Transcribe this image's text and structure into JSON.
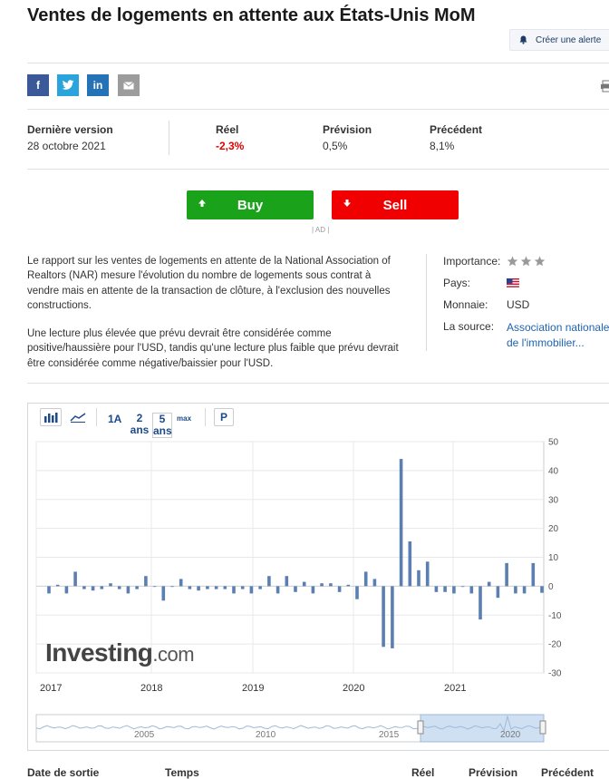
{
  "header": {
    "title": "Ventes de logements en attente aux États-Unis MoM",
    "alert_button": "Créer une alerte"
  },
  "share": [
    {
      "name": "facebook-share-button",
      "glyph": "f",
      "color": "#3b5998"
    },
    {
      "name": "twitter-share-button",
      "glyph": "t",
      "color": "#2ba4db"
    },
    {
      "name": "linkedin-share-button",
      "glyph": "in",
      "color": "#2572b6"
    },
    {
      "name": "email-share-button",
      "glyph": "✉",
      "color": "#9c9c9c"
    }
  ],
  "stats": {
    "version_label": "Dernière version",
    "version_date": "28 octobre 2021",
    "actual_label": "Réel",
    "actual_value": "-2,3%",
    "forecast_label": "Prévision",
    "forecast_value": "0,5%",
    "previous_label": "Précédent",
    "previous_value": "8,1%",
    "actual_color": "#e00000"
  },
  "trade": {
    "buy_label": "Buy",
    "sell_label": "Sell",
    "ad_label": "| AD |",
    "buy_color": "#1aa31a",
    "sell_color": "#f00000"
  },
  "description": {
    "paragraph1": "Le rapport sur les ventes de logements en attente de la National Association of Realtors (NAR) mesure l'évolution du nombre de logements sous contrat à vendre mais en attente de la transaction de clôture, à l'exclusion des nouvelles constructions.",
    "paragraph2": "Une lecture plus élevée que prévu devrait être considérée comme positive/haussière pour l'USD, tandis qu'une lecture plus faible que prévu devrait être considérée comme négative/baissier pour l'USD."
  },
  "info": {
    "importance_label": "Importance:",
    "importance_stars": 3,
    "country_label": "Pays:",
    "currency_label": "Monnaie:",
    "currency_value": "USD",
    "source_label": "La source:",
    "source_value": "Association nationale de l'immobilier..."
  },
  "toolbar": {
    "range_1y": "1A",
    "range_2y": "2 ans",
    "range_5y": "5 ans",
    "range_max": "max",
    "p_button": "P"
  },
  "chart_data": {
    "type": "bar",
    "ylim": [
      -30,
      50
    ],
    "y_ticks": [
      "50",
      "40",
      "30",
      "20",
      "10",
      "0",
      "-10",
      "-20",
      "-30"
    ],
    "x_tick_labels": [
      "2017",
      "2018",
      "2019",
      "2020",
      "2021"
    ],
    "color": "#5b7fb0",
    "grid": true,
    "values": [
      -2.5,
      0.5,
      -2.5,
      5.0,
      -1.0,
      -1.5,
      -1.0,
      1.0,
      -1.0,
      -2.5,
      -1.0,
      3.5,
      0.0,
      -5.0,
      0.0,
      2.5,
      -1.0,
      -1.5,
      -1.0,
      -1.0,
      -1.0,
      -2.5,
      -1.0,
      -2.5,
      -1.0,
      3.5,
      -2.5,
      3.5,
      -2.0,
      1.5,
      -2.5,
      1.0,
      1.0,
      -2.0,
      0.5,
      -4.5,
      5.0,
      2.5,
      -21.0,
      -21.5,
      44.0,
      15.5,
      5.5,
      8.5,
      -2.0,
      -2.0,
      -2.5,
      0.0,
      -2.5,
      -11.5,
      1.5,
      -4.0,
      8.0,
      -2.5,
      -2.5,
      8.0,
      -2.3
    ],
    "navigator_labels": [
      "2005",
      "2010",
      "2015",
      "2020"
    ]
  },
  "watermark": {
    "brand": "Investing",
    "suffix": ".com"
  },
  "table_header": {
    "release_date": "Date de sortie",
    "time": "Temps",
    "actual": "Réel",
    "forecast": "Prévision",
    "previous": "Précédent"
  }
}
